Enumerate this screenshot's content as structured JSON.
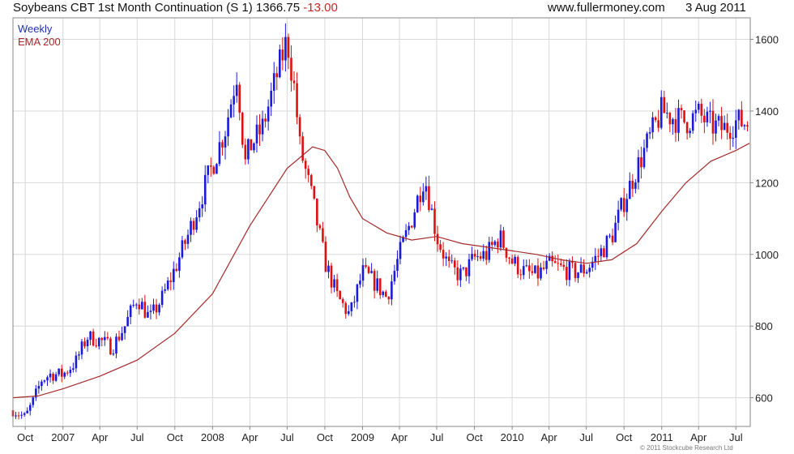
{
  "header": {
    "title": "Soybeans CBT 1st Month Continuation (S 1)",
    "last": "1366.75",
    "change": "-13.00",
    "site": "www.fullermoney.com",
    "date": "3 Aug 2011"
  },
  "footer": {
    "copyright": "© 2011 Stockcube Research Ltd"
  },
  "colors": {
    "up": "#1a1adb",
    "down": "#dd1111",
    "ema": "#a52a2a",
    "grid": "#d8d8d8",
    "frame": "#888888",
    "legend_weekly": "#2233aa",
    "legend_ema": "#a52a2a"
  },
  "chart_data": {
    "type": "candlestick",
    "frequency": "weekly",
    "x_range": [
      "2006-09-01",
      "2011-08-05"
    ],
    "ylim": [
      520,
      1660
    ],
    "y_ticks": [
      600,
      800,
      1000,
      1200,
      1400,
      1600
    ],
    "x_ticks": [
      {
        "date": "2006-10-01",
        "label": "Oct"
      },
      {
        "date": "2007-01-01",
        "label": "2007"
      },
      {
        "date": "2007-04-01",
        "label": "Apr"
      },
      {
        "date": "2007-07-01",
        "label": "Jul"
      },
      {
        "date": "2007-10-01",
        "label": "Oct"
      },
      {
        "date": "2008-01-01",
        "label": "2008"
      },
      {
        "date": "2008-04-01",
        "label": "Apr"
      },
      {
        "date": "2008-07-01",
        "label": "Jul"
      },
      {
        "date": "2008-10-01",
        "label": "Oct"
      },
      {
        "date": "2009-01-01",
        "label": "2009"
      },
      {
        "date": "2009-04-01",
        "label": "Apr"
      },
      {
        "date": "2009-07-01",
        "label": "Jul"
      },
      {
        "date": "2009-10-01",
        "label": "Oct"
      },
      {
        "date": "2010-01-01",
        "label": "2010"
      },
      {
        "date": "2010-04-01",
        "label": "Apr"
      },
      {
        "date": "2010-07-01",
        "label": "Jul"
      },
      {
        "date": "2010-10-01",
        "label": "Oct"
      },
      {
        "date": "2011-01-01",
        "label": "2011"
      },
      {
        "date": "2011-04-01",
        "label": "Apr"
      },
      {
        "date": "2011-07-01",
        "label": "Jul"
      }
    ],
    "grid": true,
    "legend": [
      {
        "name": "Weekly",
        "position": "top-left"
      },
      {
        "name": "EMA 200",
        "position": "top-left"
      }
    ],
    "series": [
      {
        "name": "Weekly",
        "kind": "ohlc-close-path",
        "points": [
          [
            "2006-09-01",
            565
          ],
          [
            "2006-10-01",
            545
          ],
          [
            "2006-10-20",
            590
          ],
          [
            "2006-11-10",
            650
          ],
          [
            "2006-12-01",
            665
          ],
          [
            "2007-01-01",
            665
          ],
          [
            "2007-02-01",
            700
          ],
          [
            "2007-03-01",
            770
          ],
          [
            "2007-04-01",
            760
          ],
          [
            "2007-05-01",
            740
          ],
          [
            "2007-06-01",
            800
          ],
          [
            "2007-07-01",
            880
          ],
          [
            "2007-08-01",
            820
          ],
          [
            "2007-09-01",
            880
          ],
          [
            "2007-10-01",
            960
          ],
          [
            "2007-11-01",
            1050
          ],
          [
            "2007-12-01",
            1150
          ],
          [
            "2008-01-01",
            1250
          ],
          [
            "2008-02-01",
            1350
          ],
          [
            "2008-03-01",
            1510
          ],
          [
            "2008-03-20",
            1250
          ],
          [
            "2008-04-01",
            1300
          ],
          [
            "2008-05-01",
            1350
          ],
          [
            "2008-06-01",
            1480
          ],
          [
            "2008-07-01",
            1600
          ],
          [
            "2008-07-20",
            1450
          ],
          [
            "2008-08-01",
            1300
          ],
          [
            "2008-09-01",
            1150
          ],
          [
            "2008-10-01",
            980
          ],
          [
            "2008-11-01",
            880
          ],
          [
            "2008-12-01",
            830
          ],
          [
            "2009-01-01",
            950
          ],
          [
            "2009-02-01",
            920
          ],
          [
            "2009-03-01",
            880
          ],
          [
            "2009-04-01",
            1000
          ],
          [
            "2009-05-01",
            1100
          ],
          [
            "2009-06-01",
            1220
          ],
          [
            "2009-07-01",
            1050
          ],
          [
            "2009-08-01",
            960
          ],
          [
            "2009-09-01",
            940
          ],
          [
            "2009-10-01",
            990
          ],
          [
            "2009-11-01",
            1000
          ],
          [
            "2009-12-01",
            1050
          ],
          [
            "2010-01-01",
            980
          ],
          [
            "2010-02-01",
            950
          ],
          [
            "2010-03-01",
            940
          ],
          [
            "2010-04-01",
            970
          ],
          [
            "2010-05-01",
            960
          ],
          [
            "2010-06-01",
            950
          ],
          [
            "2010-07-01",
            960
          ],
          [
            "2010-08-01",
            1000
          ],
          [
            "2010-09-01",
            1050
          ],
          [
            "2010-10-01",
            1150
          ],
          [
            "2010-11-01",
            1240
          ],
          [
            "2010-12-01",
            1320
          ],
          [
            "2011-01-01",
            1400
          ],
          [
            "2011-02-01",
            1380
          ],
          [
            "2011-03-01",
            1370
          ],
          [
            "2011-04-01",
            1390
          ],
          [
            "2011-05-01",
            1360
          ],
          [
            "2011-06-01",
            1350
          ],
          [
            "2011-07-01",
            1370
          ],
          [
            "2011-08-03",
            1366.75
          ]
        ]
      },
      {
        "name": "EMA 200",
        "kind": "line",
        "points": [
          [
            "2006-09-01",
            600
          ],
          [
            "2006-11-01",
            605
          ],
          [
            "2007-01-01",
            625
          ],
          [
            "2007-04-01",
            660
          ],
          [
            "2007-07-01",
            705
          ],
          [
            "2007-10-01",
            780
          ],
          [
            "2008-01-01",
            890
          ],
          [
            "2008-04-01",
            1080
          ],
          [
            "2008-07-01",
            1240
          ],
          [
            "2008-09-01",
            1300
          ],
          [
            "2008-10-01",
            1290
          ],
          [
            "2008-11-01",
            1240
          ],
          [
            "2008-12-01",
            1160
          ],
          [
            "2009-01-01",
            1100
          ],
          [
            "2009-03-01",
            1060
          ],
          [
            "2009-05-01",
            1040
          ],
          [
            "2009-07-01",
            1050
          ],
          [
            "2009-09-01",
            1030
          ],
          [
            "2009-11-01",
            1020
          ],
          [
            "2010-01-01",
            1010
          ],
          [
            "2010-03-01",
            1000
          ],
          [
            "2010-05-01",
            985
          ],
          [
            "2010-07-01",
            975
          ],
          [
            "2010-09-01",
            985
          ],
          [
            "2010-11-01",
            1030
          ],
          [
            "2011-01-01",
            1120
          ],
          [
            "2011-03-01",
            1200
          ],
          [
            "2011-05-01",
            1260
          ],
          [
            "2011-07-01",
            1290
          ],
          [
            "2011-08-03",
            1310
          ]
        ]
      }
    ]
  }
}
